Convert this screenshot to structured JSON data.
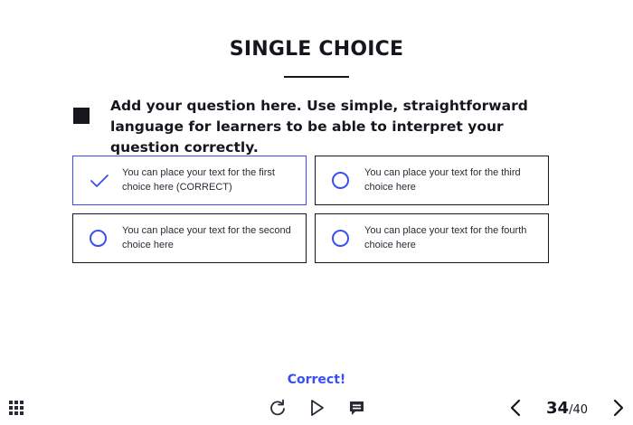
{
  "slide": {
    "title": "SINGLE CHOICE",
    "question": "Add your question here. Use simple, straightforward language for learners to be able to interpret your question correctly."
  },
  "choices": [
    {
      "text": "You can place your text for the first choice here (CORRECT)",
      "selected": true,
      "icon": "check-icon"
    },
    {
      "text": "You can place your text for the second choice here",
      "selected": false,
      "icon": "radio-icon"
    },
    {
      "text": "You can place your text for the third choice here",
      "selected": false,
      "icon": "radio-icon"
    },
    {
      "text": "You can place your text for the fourth choice here",
      "selected": false,
      "icon": "radio-icon"
    }
  ],
  "feedback": "Correct!",
  "player": {
    "current_page": "34",
    "total_pages": "/40",
    "icons": [
      "grid-menu-icon",
      "replay-icon",
      "play-icon",
      "captions-icon",
      "chevron-left-icon",
      "chevron-right-icon"
    ]
  },
  "colors": {
    "accent": "#3b4ef0",
    "text": "#16161f",
    "background": "#ffffff"
  }
}
